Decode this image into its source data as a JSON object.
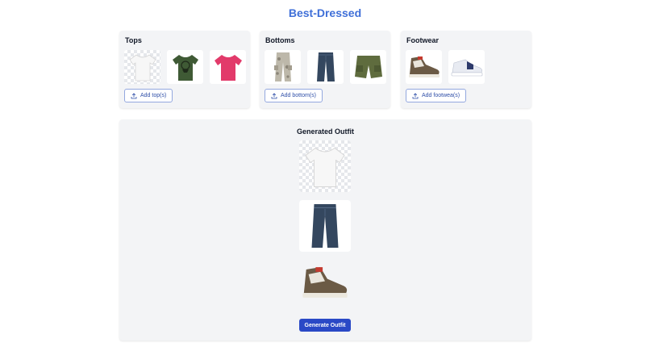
{
  "app": {
    "title": "Best-Dressed"
  },
  "categories": [
    {
      "title": "Tops",
      "upload_label": "Add top(s)",
      "items": [
        {
          "icon": "white-tshirt",
          "color": "#f4f4f4"
        },
        {
          "icon": "green-graphic-tshirt",
          "color": "#3f5a35"
        },
        {
          "icon": "pink-tshirt",
          "color": "#e23a6a"
        }
      ]
    },
    {
      "title": "Bottoms",
      "upload_label": "Add bottom(s)",
      "items": [
        {
          "icon": "camo-cargo-pants",
          "color": "#b9b4a6"
        },
        {
          "icon": "denim-jeans",
          "color": "#34475f"
        },
        {
          "icon": "olive-cargo-shorts",
          "color": "#5f6c3e"
        }
      ]
    },
    {
      "title": "Footwear",
      "upload_label": "Add footwea(s)",
      "items": [
        {
          "icon": "brown-highlow-sneaker",
          "color": "#6b5a45"
        },
        {
          "icon": "white-blue-sneaker",
          "color": "#d9dde6"
        }
      ]
    }
  ],
  "outfit": {
    "title": "Generated Outfit",
    "top_icon": "white-tshirt",
    "bottom_icon": "denim-jeans",
    "shoe_icon": "brown-highlow-sneaker",
    "generate_label": "Generate Outfit"
  },
  "colors": {
    "accent": "#2a49c6",
    "title": "#3f6fd8",
    "panel": "#f3f4f6"
  }
}
